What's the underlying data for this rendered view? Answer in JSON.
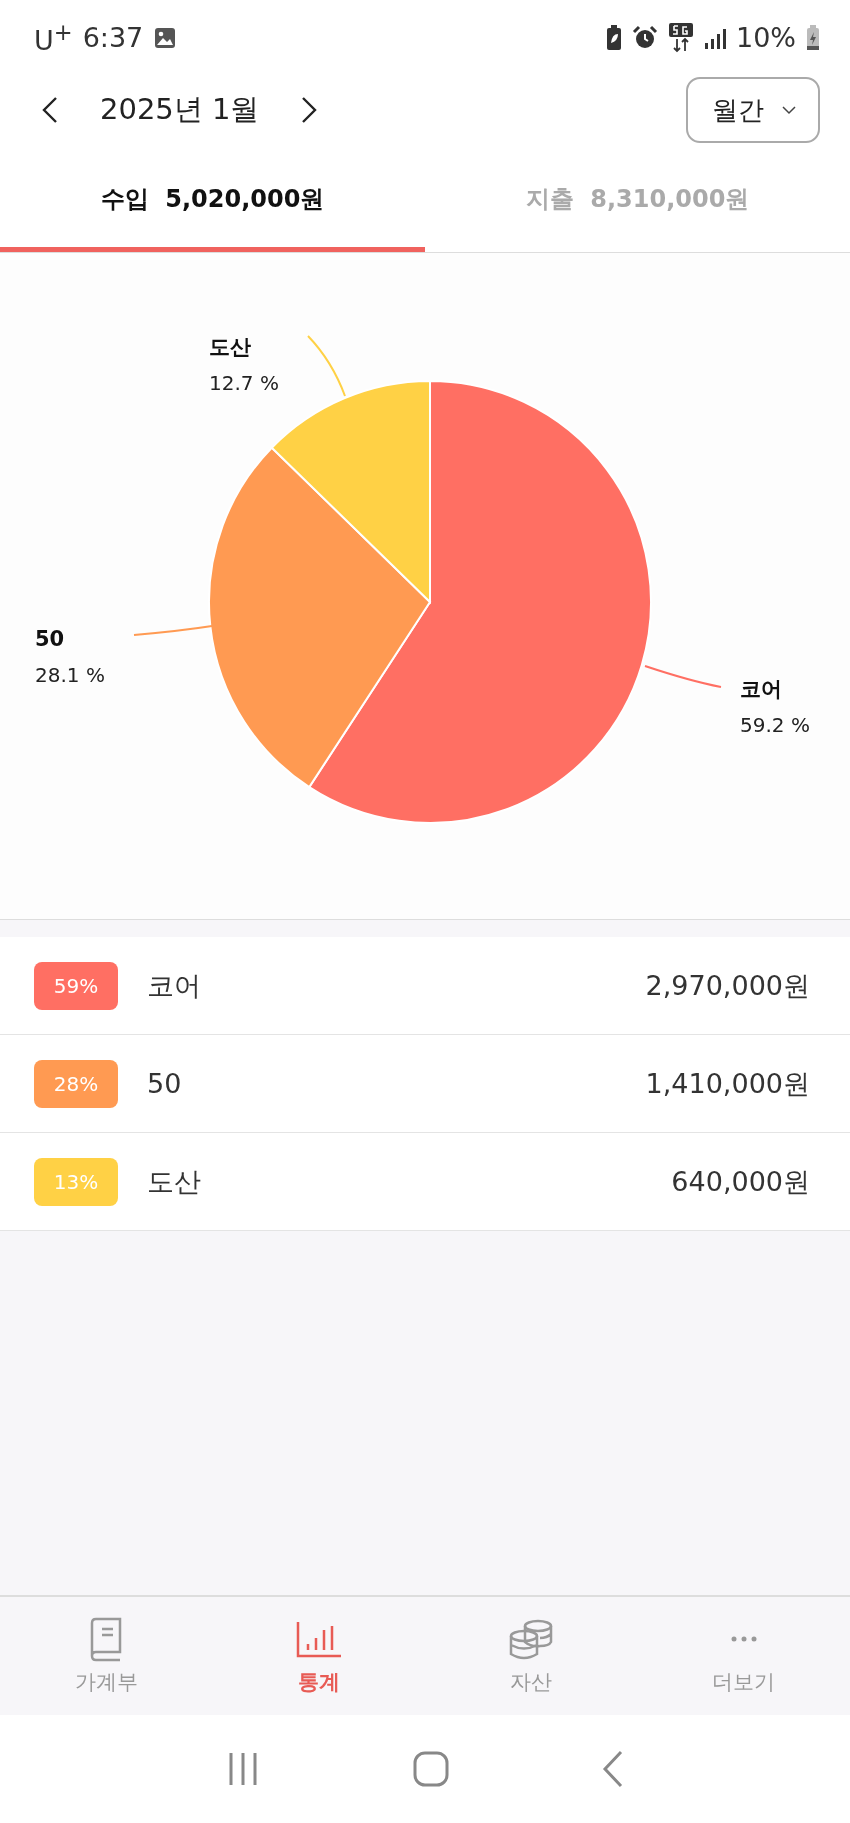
{
  "status_bar": {
    "carrier": "U$^{+}$",
    "time": "6:37",
    "battery": "10%"
  },
  "header": {
    "period": "2025년 1월",
    "view_select": "월간"
  },
  "tabs": [
    {
      "label": "수입",
      "amount": "5,020,000원",
      "selected": true
    },
    {
      "label": "지출",
      "amount": "8,310,000원",
      "selected": false
    }
  ],
  "chart": {
    "chart_data": {
      "type": "pie",
      "categories": [
        "코어",
        "50",
        "도산"
      ],
      "values": [
        59.2,
        28.1,
        12.7
      ],
      "value_labels": [
        "59.2 %",
        "28.1 %",
        "12.7 %"
      ]
    }
  },
  "categories": [
    {
      "percent": "59%",
      "name": "코어",
      "amount": "2,970,000원",
      "color": "#ff6f63"
    },
    {
      "percent": "28%",
      "name": "50",
      "amount": "1,410,000원",
      "color": "#ff9a52"
    },
    {
      "percent": "13%",
      "name": "도산",
      "amount": "640,000원",
      "color": "#ffd145"
    }
  ],
  "bottom_nav": [
    {
      "label": "가계부",
      "kind": "book",
      "selected": false
    },
    {
      "label": "통계",
      "kind": "chart",
      "selected": true
    },
    {
      "label": "자산",
      "kind": "coins",
      "selected": false
    },
    {
      "label": "더보기",
      "kind": "more",
      "selected": false
    }
  ]
}
